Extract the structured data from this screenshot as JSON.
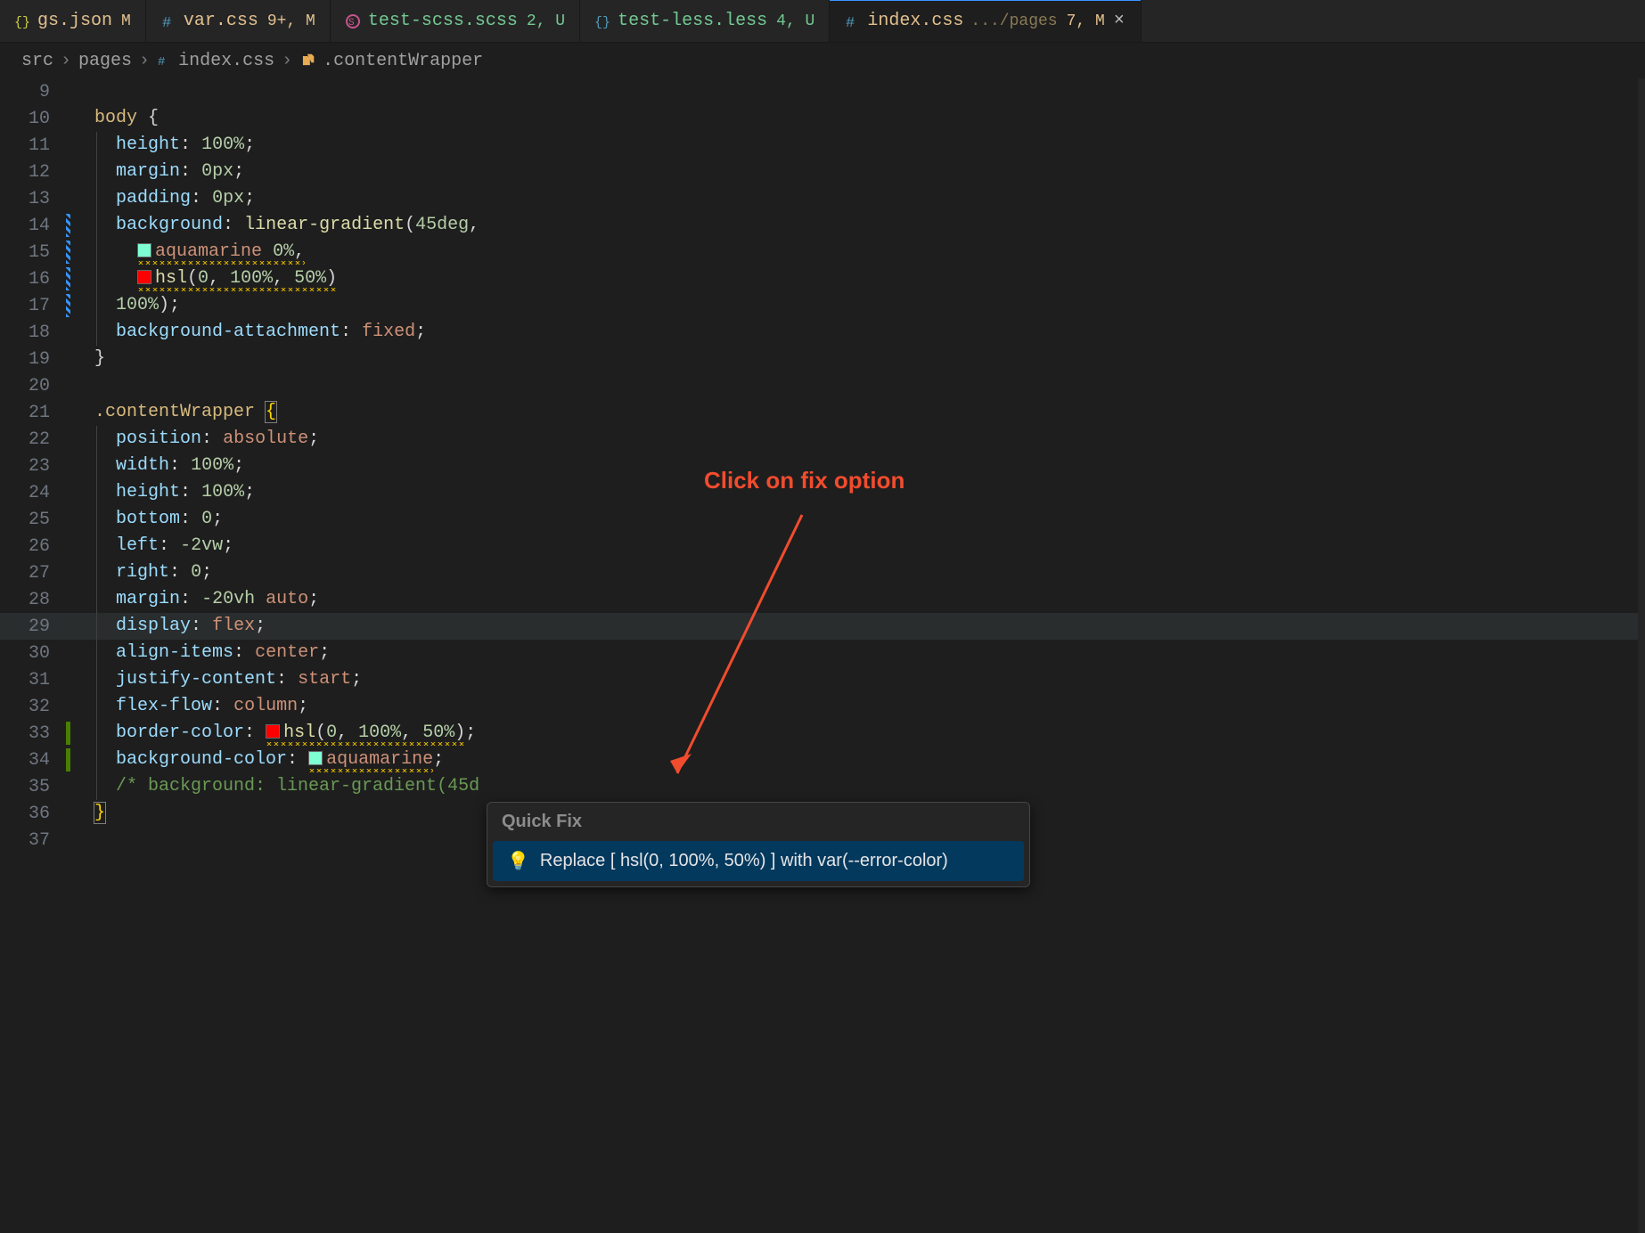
{
  "tabs": [
    {
      "name": "gs.json",
      "filename": "gs.json",
      "badge": "M",
      "status": "m",
      "kind": "json"
    },
    {
      "name": "var.css",
      "filename": "var.css",
      "badge": "9+, M",
      "status": "m",
      "kind": "css"
    },
    {
      "name": "test-scss.scss",
      "filename": "test-scss.scss",
      "badge": "2, U",
      "status": "u",
      "kind": "scss"
    },
    {
      "name": "test-less.less",
      "filename": "test-less.less",
      "badge": "4, U",
      "status": "u",
      "kind": "less"
    },
    {
      "name": "index.css",
      "filename": "index.css",
      "suffix": ".../pages",
      "badge": "7, M",
      "status": "m",
      "kind": "css",
      "active": true,
      "closeable": true
    }
  ],
  "breadcrumb": {
    "parts": [
      "src",
      "pages"
    ],
    "file": "index.css",
    "symbol": ".contentWrapper"
  },
  "lineStart": 9,
  "code": [
    {
      "n": 9,
      "raw": ""
    },
    {
      "n": 10,
      "raw": "body {"
    },
    {
      "n": 11,
      "raw": "  height:100%;"
    },
    {
      "n": 12,
      "raw": "  margin:0px;"
    },
    {
      "n": 13,
      "raw": "  padding:0px;"
    },
    {
      "n": 14,
      "raw": "  background: linear-gradient(45deg,",
      "marker": "blue"
    },
    {
      "n": 15,
      "raw": "    aquamarine 0%,",
      "marker": "blue",
      "swatch": "#7fffd4",
      "squig": true,
      "squigText": "aquamarine 0%"
    },
    {
      "n": 16,
      "raw": "    hsl(0, 100%, 50%)",
      "marker": "blue",
      "swatch": "#ff0000",
      "squig": true,
      "squigText": "hsl(0, 100%, 50%)"
    },
    {
      "n": 17,
      "raw": "  100%);",
      "marker": "blue"
    },
    {
      "n": 18,
      "raw": "  background-attachment: fixed;"
    },
    {
      "n": 19,
      "raw": "}"
    },
    {
      "n": 20,
      "raw": ""
    },
    {
      "n": 21,
      "raw": ".contentWrapper {",
      "cursorBraceOpen": true
    },
    {
      "n": 22,
      "raw": "  position: absolute;"
    },
    {
      "n": 23,
      "raw": "  width: 100%;"
    },
    {
      "n": 24,
      "raw": "  height: 100%;"
    },
    {
      "n": 25,
      "raw": "  bottom: 0;"
    },
    {
      "n": 26,
      "raw": "  left: -2vw;"
    },
    {
      "n": 27,
      "raw": "  right: 0;"
    },
    {
      "n": 28,
      "raw": "  margin: -20vh auto;"
    },
    {
      "n": 29,
      "raw": "  display: flex;",
      "highlight": true
    },
    {
      "n": 30,
      "raw": "  align-items: center;"
    },
    {
      "n": 31,
      "raw": "  justify-content: start;"
    },
    {
      "n": 32,
      "raw": "  flex-flow: column;"
    },
    {
      "n": 33,
      "raw": "  border-color: hsl(0, 100%, 50%);",
      "marker": "green",
      "swatch": "#ff0000",
      "squig": true,
      "squigText": "hsl(0, 100%, 50%)"
    },
    {
      "n": 34,
      "raw": "  background-color: aquamarine;",
      "marker": "green",
      "swatch": "#7fffd4",
      "squig": true,
      "squigText": "aquamarine"
    },
    {
      "n": 35,
      "raw": "  /* background: linear-gradient(45d"
    },
    {
      "n": 36,
      "raw": "}",
      "cursorBraceClose": true
    },
    {
      "n": 37,
      "raw": ""
    }
  ],
  "quickfix": {
    "title": "Quick Fix",
    "action": "Replace [ hsl(0, 100%, 50%) ] with var(--error-color)"
  },
  "annotation": {
    "text": "Click on fix option"
  },
  "colors": {
    "aquamarine": "#7fffd4",
    "red": "#ff0000"
  }
}
